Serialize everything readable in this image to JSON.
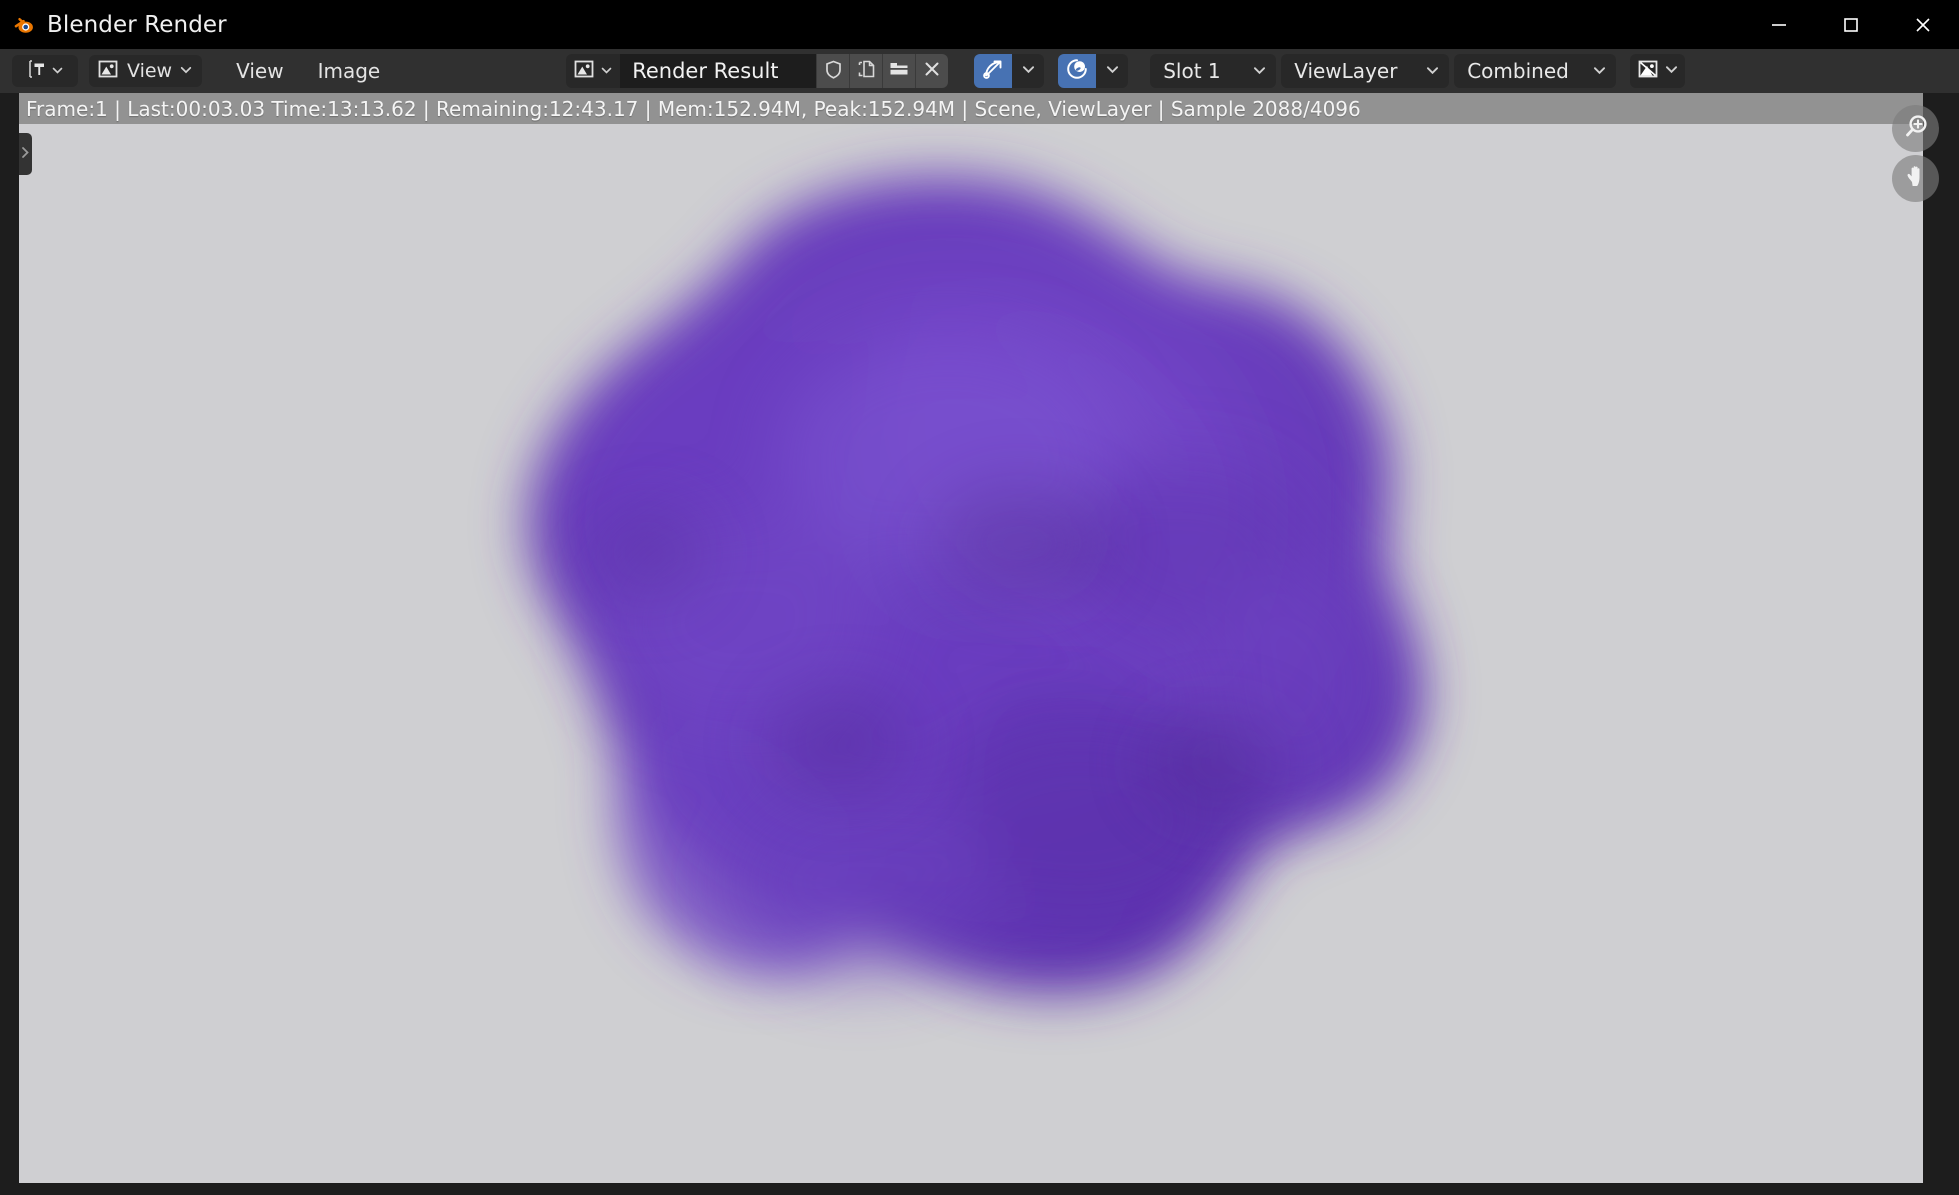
{
  "window": {
    "title": "Blender Render",
    "logo_icon": "blender-logo-icon",
    "minimize_label": "—",
    "maximize_label": "☐",
    "close_label": "✕"
  },
  "header": {
    "editor_type_icon": "image-editor-type-icon",
    "view_mode_icon": "image-view-mode-icon",
    "menus": [
      {
        "label": "View",
        "name": "menu-view"
      },
      {
        "label": "Image",
        "name": "menu-image"
      }
    ],
    "datablock": {
      "icon": "image-datablock-icon",
      "name": "Render Result",
      "fake_user_icon": "shield-icon",
      "new_copy_icon": "copy-icon",
      "open_icon": "folder-icon",
      "unlink_icon": "close-x-icon"
    },
    "toggles": [
      {
        "name": "render-region-toggle",
        "icon": "trajectory-icon",
        "active": true
      },
      {
        "name": "view-as-render-toggle",
        "icon": "sphere-icon",
        "active": true
      }
    ],
    "slot": {
      "label": "Slot 1"
    },
    "viewlayer": {
      "label": "ViewLayer"
    },
    "pass": {
      "label": "Combined"
    },
    "display_channels_icon": "display-channels-icon",
    "chevron": "⌄"
  },
  "status": {
    "text": "Frame:1 | Last:00:03.03 Time:13:13.62 | Remaining:12:43.17 | Mem:152.94M, Peak:152.94M | Scene, ViewLayer | Sample 2088/4096",
    "frame": "1",
    "last": "00:03.03",
    "time": "13:13.62",
    "remaining": "12:43.17",
    "mem": "152.94M",
    "peak": "152.94M",
    "scene": "Scene",
    "viewlayer": "ViewLayer",
    "sample_current": "2088",
    "sample_total": "4096"
  },
  "canvas": {
    "background_color": "#cfcfd2",
    "blob_color": "#6b3fbf",
    "blob_dark_color": "#4c2b8c",
    "side_panel_arrow_icon": "chevron-right-icon",
    "gizmos": [
      {
        "name": "zoom-gizmo",
        "icon": "magnifier-plus-icon"
      },
      {
        "name": "pan-gizmo",
        "icon": "hand-icon"
      }
    ]
  },
  "colors": {
    "titlebar": "#000000",
    "header": "#303030",
    "accent_blue": "#4772b3",
    "blender_orange": "#ea7600"
  }
}
